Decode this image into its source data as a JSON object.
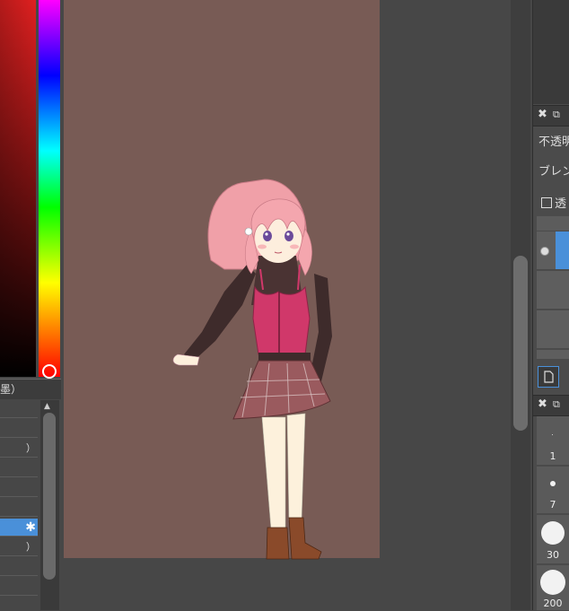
{
  "color_panel": {
    "hue_colors": [
      "#ff00ff",
      "#0000ff",
      "#00ffff",
      "#00ff00",
      "#ffff00",
      "#ff0000"
    ],
    "base_color": "#e02020"
  },
  "brush_panel": {
    "header": "墨）",
    "rows": [
      "",
      "",
      "）",
      "",
      "",
      "",
      "",
      "）",
      "",
      ""
    ],
    "selected_index": 6
  },
  "canvas": {
    "background": "#785b55"
  },
  "right_panel": {
    "layer_head_icons": {
      "close": "✖",
      "popout": "⧉"
    },
    "opacity_label": "不透明",
    "blend_label": "ブレン",
    "lock_label": "透",
    "brush_head_icons": {
      "close": "✖",
      "popout": "⧉"
    },
    "sizes": [
      {
        "label": "1"
      },
      {
        "label": "7"
      },
      {
        "label": "30"
      },
      {
        "label": "200"
      }
    ]
  }
}
